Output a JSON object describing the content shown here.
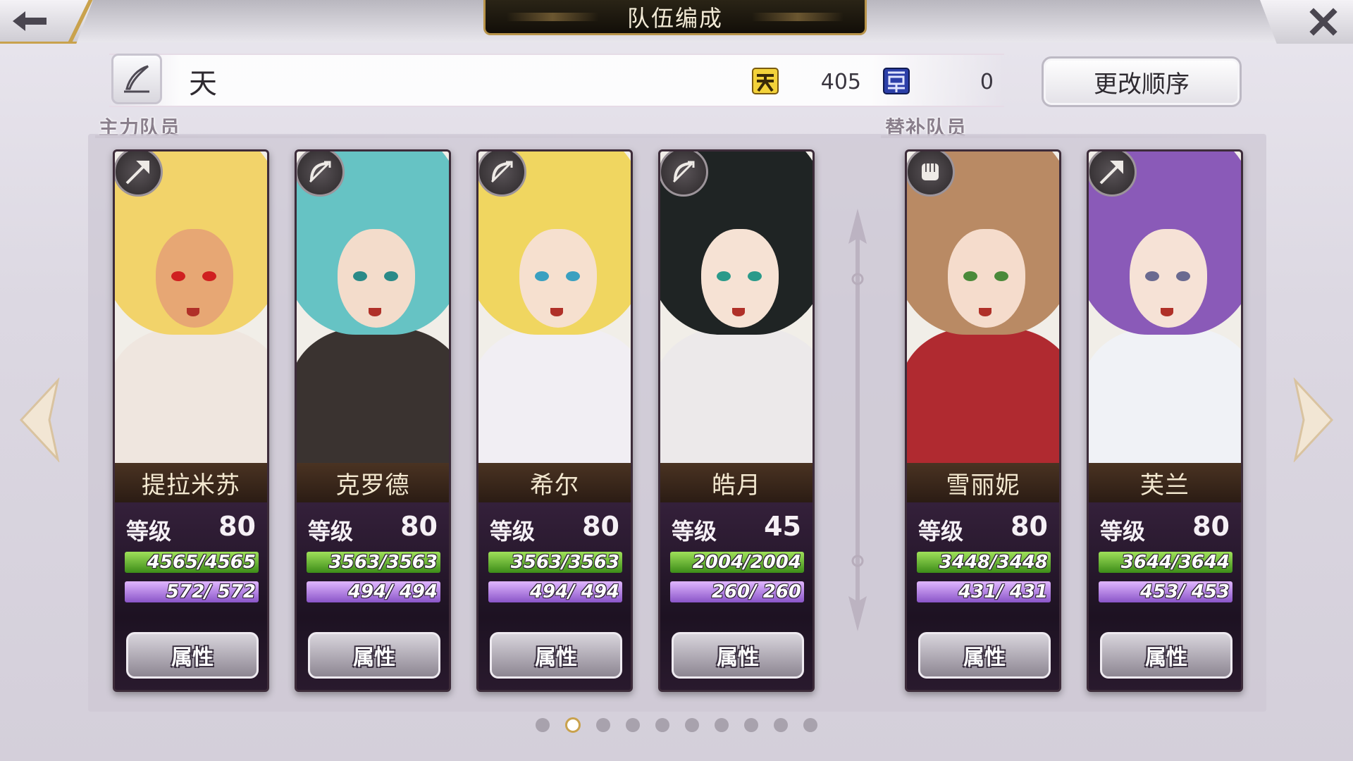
{
  "header": {
    "title": "队伍编成"
  },
  "team": {
    "name": "天",
    "sky_value": "405",
    "dark_value": "0",
    "reorder_label": "更改顺序"
  },
  "sections": {
    "main_label": "主力队员",
    "sub_label": "替补队员"
  },
  "main_members": [
    {
      "name": "提拉米苏",
      "level_label": "等级",
      "level": "80",
      "hp": "4565/4565",
      "mp": "572/ 572",
      "attr_label": "属性",
      "class_icon": "spear-icon"
    },
    {
      "name": "克罗德",
      "level_label": "等级",
      "level": "80",
      "hp": "3563/3563",
      "mp": "494/ 494",
      "attr_label": "属性",
      "class_icon": "bow-icon"
    },
    {
      "name": "希尔",
      "level_label": "等级",
      "level": "80",
      "hp": "3563/3563",
      "mp": "494/ 494",
      "attr_label": "属性",
      "class_icon": "bow-icon"
    },
    {
      "name": "皓月",
      "level_label": "等级",
      "level": "45",
      "hp": "2004/2004",
      "mp": "260/ 260",
      "attr_label": "属性",
      "class_icon": "bow-icon"
    }
  ],
  "sub_members": [
    {
      "name": "雪丽妮",
      "level_label": "等级",
      "level": "80",
      "hp": "3448/3448",
      "mp": "431/ 431",
      "attr_label": "属性",
      "class_icon": "fist-icon"
    },
    {
      "name": "芙兰",
      "level_label": "等级",
      "level": "80",
      "hp": "3644/3644",
      "mp": "453/ 453",
      "attr_label": "属性",
      "class_icon": "spear-icon"
    }
  ],
  "pagination": {
    "count": 10,
    "active_index": 1
  },
  "colors": {
    "accent_gold": "#c9a24d",
    "hp_green": "#3c8c18",
    "mp_purple": "#8a55c8"
  }
}
